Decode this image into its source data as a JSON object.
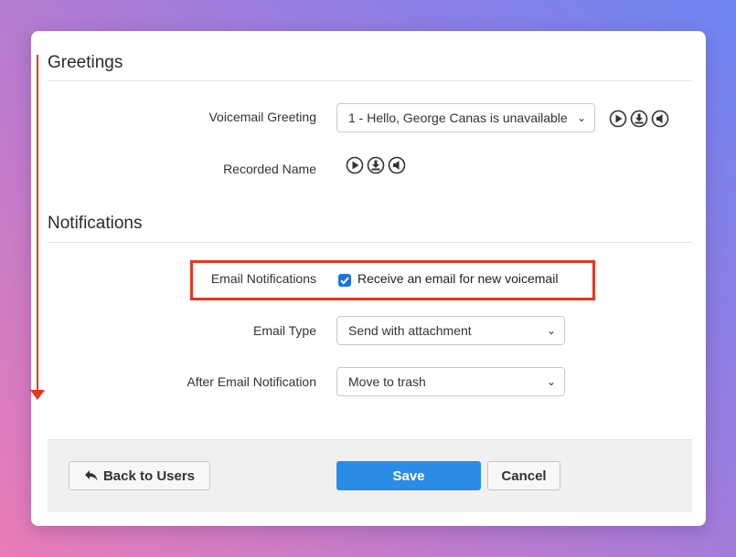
{
  "greetings": {
    "title": "Greetings",
    "voicemail_greeting": {
      "label": "Voicemail Greeting",
      "value": "1 - Hello, George Canas is unavailable"
    },
    "recorded_name": {
      "label": "Recorded Name"
    }
  },
  "notifications": {
    "title": "Notifications",
    "email_notifications": {
      "label": "Email Notifications",
      "checkbox_label": "Receive an email for new voicemail",
      "checked": true
    },
    "email_type": {
      "label": "Email Type",
      "value": "Send with attachment"
    },
    "after_email": {
      "label": "After Email Notification",
      "value": "Move to trash"
    }
  },
  "footer": {
    "back_label": "Back to Users",
    "save_label": "Save",
    "cancel_label": "Cancel"
  },
  "colors": {
    "primary": "#2b8ce8",
    "highlight": "#e8341c",
    "checkbox": "#1a73e8"
  },
  "icons": [
    "play-icon",
    "download-icon",
    "speaker-icon",
    "reply-arrow-icon",
    "chevron-down-icon",
    "checkmark-icon"
  ]
}
